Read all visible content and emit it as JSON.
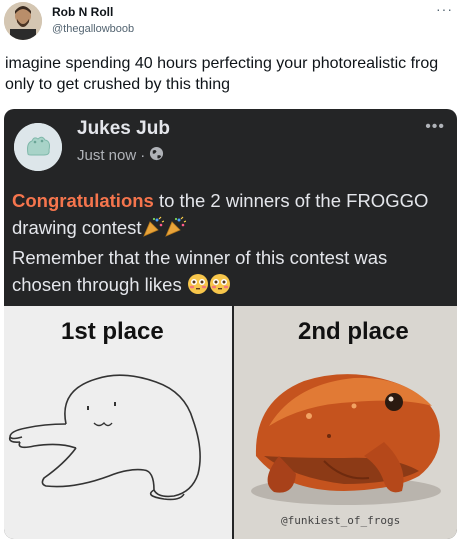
{
  "tweet": {
    "author_name": "Rob N Roll",
    "author_handle": "@thegallowboob",
    "more_label": "···",
    "text": "imagine spending 40 hours perfecting your photorealistic frog only to get crushed by this thing"
  },
  "embed": {
    "page_name": "Jukes Jub",
    "timestamp": "Just now",
    "separator": "·",
    "privacy_icon": "globe-icon",
    "more_label": "•••",
    "post_highlight": "Congratulations",
    "post_line1_rest": " to the 2 winners of the FROGGO drawing contest",
    "post_line2": "Remember that the winner of this contest was chosen through likes",
    "emojis": [
      "party-popper",
      "party-popper",
      "flushed-face",
      "flushed-face"
    ],
    "images": [
      {
        "label": "1st place"
      },
      {
        "label": "2nd place",
        "watermark": "@funkiest_of_frogs"
      }
    ]
  },
  "colors": {
    "card_bg": "#242526",
    "highlight": "#f5754d",
    "fb_text": "#e4e6eb",
    "fb_secondary": "#b0b3b8"
  }
}
